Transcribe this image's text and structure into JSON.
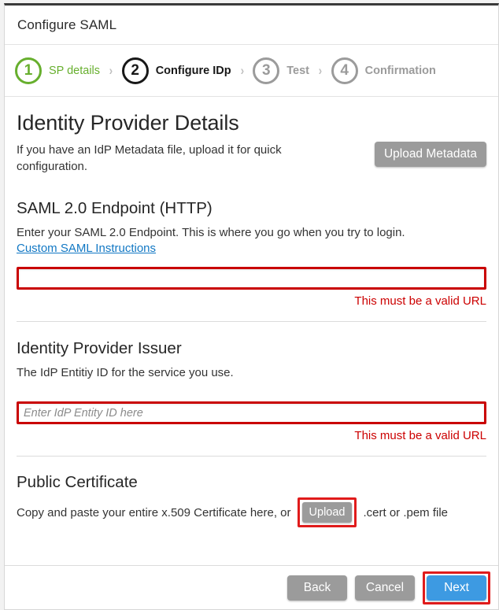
{
  "window": {
    "title": "Configure SAML"
  },
  "stepper": {
    "separator": "›",
    "steps": [
      {
        "number": "1",
        "label": "SP details",
        "state": "done"
      },
      {
        "number": "2",
        "label": "Configure IDp",
        "state": "current"
      },
      {
        "number": "3",
        "label": "Test",
        "state": "upcoming"
      },
      {
        "number": "4",
        "label": "Confirmation",
        "state": "upcoming"
      }
    ]
  },
  "main": {
    "heading": "Identity Provider Details",
    "intro_text": "If you have an IdP Metadata file, upload it for quick configuration.",
    "upload_metadata_label": "Upload Metadata",
    "endpoint": {
      "heading": "SAML 2.0 Endpoint (HTTP)",
      "description": "Enter your SAML 2.0 Endpoint. This is where you go when you try to login.",
      "link_label": "Custom SAML Instructions",
      "value": "",
      "placeholder": "",
      "error": "This must be a valid URL"
    },
    "issuer": {
      "heading": "Identity Provider Issuer",
      "description": "The IdP Entitiy ID for the service you use.",
      "value": "",
      "placeholder": "Enter IdP Entity ID here",
      "error": "This must be a valid URL"
    },
    "certificate": {
      "heading": "Public Certificate",
      "text_before": "Copy and paste your entire x.509 Certificate here, or",
      "upload_label": "Upload",
      "text_after": ".cert or .pem file"
    }
  },
  "footer": {
    "back_label": "Back",
    "cancel_label": "Cancel",
    "next_label": "Next"
  },
  "colors": {
    "step_done": "#67af2e",
    "step_current": "#181818",
    "step_upcoming": "#9b9b9b",
    "link": "#1278c4",
    "error": "#cc0000",
    "highlight_border": "#e01b1b",
    "field_border": "#c90000",
    "button_gray": "#9b9b9b",
    "button_primary": "#3d9ae2"
  }
}
